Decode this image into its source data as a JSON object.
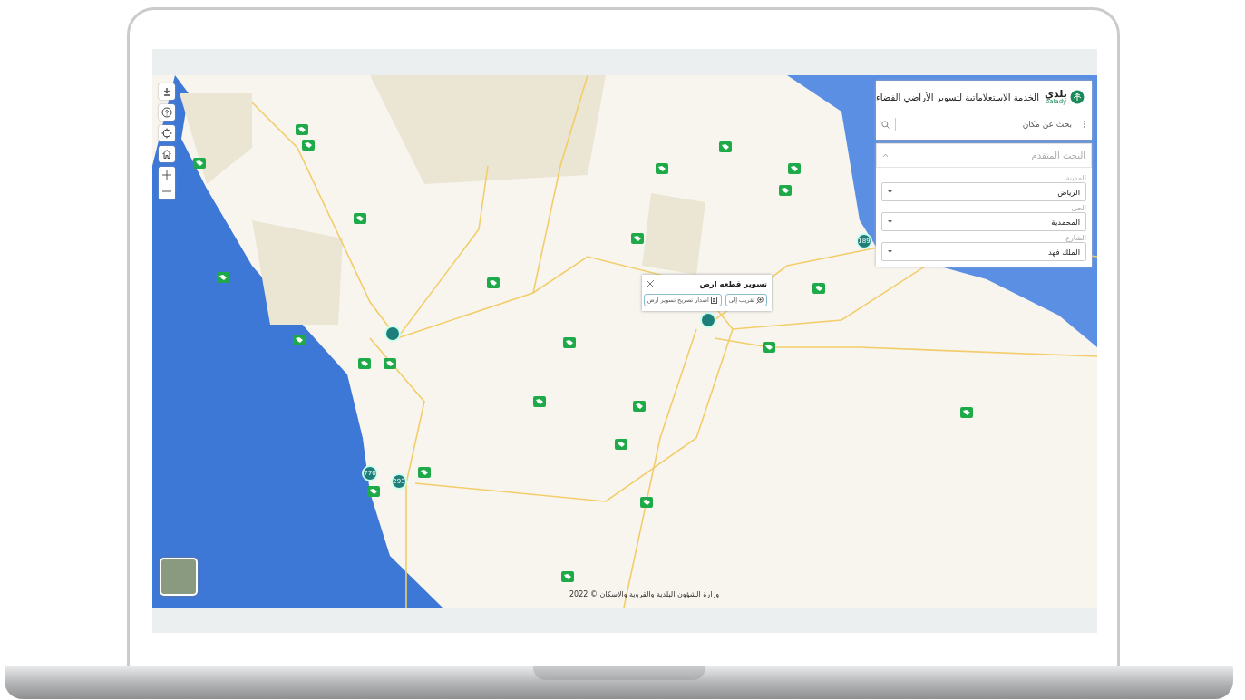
{
  "header": {
    "logo_text": "بلدي",
    "logo_subtext": "balady",
    "title": "الخدمة الاستعلاماتية لتسوير الأراضي الفضاء"
  },
  "search": {
    "placeholder": "بحث عن مكان"
  },
  "advanced_search": {
    "title": "البحث المتقدم",
    "expanded": true,
    "fields": [
      {
        "label": "المدينة",
        "value": "الرياض"
      },
      {
        "label": "الحى",
        "value": "المحمدية"
      },
      {
        "label": "الشارع",
        "value": "الملك فهد"
      }
    ]
  },
  "popup": {
    "title": "تسوير قطعه ارض",
    "buttons": [
      {
        "label": "تقريب إلى",
        "kind": "zoom"
      },
      {
        "label": "اصدار تصريح تسوير ارض",
        "kind": "permit"
      }
    ]
  },
  "clusters": [
    {
      "count": "189"
    },
    {
      "count": "770"
    },
    {
      "count": "293"
    }
  ],
  "attribution": "وزارة الشؤون البلدية والقروية والإسكان © 2022"
}
